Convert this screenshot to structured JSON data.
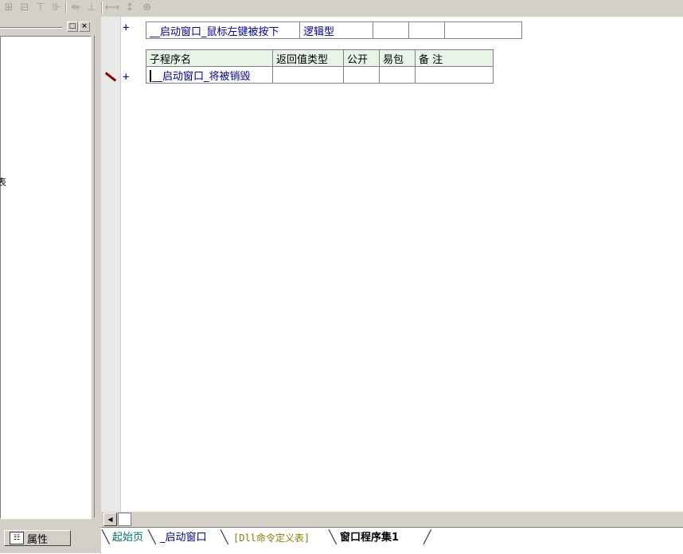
{
  "toolbar": {
    "icons": [
      "align-grid-icon",
      "align-center-icon",
      "align-top-icon",
      "align-split-icon",
      "same-width-icon",
      "same-height-icon",
      "horizontal-space-icon",
      "vertical-space-icon",
      "center-both-icon"
    ]
  },
  "left_panel": {
    "clipped_text": "表",
    "properties_tab": "属性"
  },
  "event_row": {
    "name": "__启动窗口_鼠标左键被按下",
    "return_type": "逻辑型"
  },
  "subroutine_table": {
    "headers": [
      "子程序名",
      "返回值类型",
      "公开",
      "易包",
      "备 注"
    ],
    "row": {
      "name": "__启动窗口_将被销毁",
      "return_type": "",
      "public": "",
      "easy_package": "",
      "remark": ""
    }
  },
  "bottom_tabs": [
    {
      "label": "起始页",
      "active": false
    },
    {
      "label": "_启动窗口",
      "active": false
    },
    {
      "label": "[Dll命令定义表]",
      "active": false
    },
    {
      "label": "窗口程序集1",
      "active": true
    }
  ],
  "colors": {
    "chrome": "#d4d0c8",
    "code_blue": "#0000a0",
    "marker_red": "#8b0000"
  }
}
